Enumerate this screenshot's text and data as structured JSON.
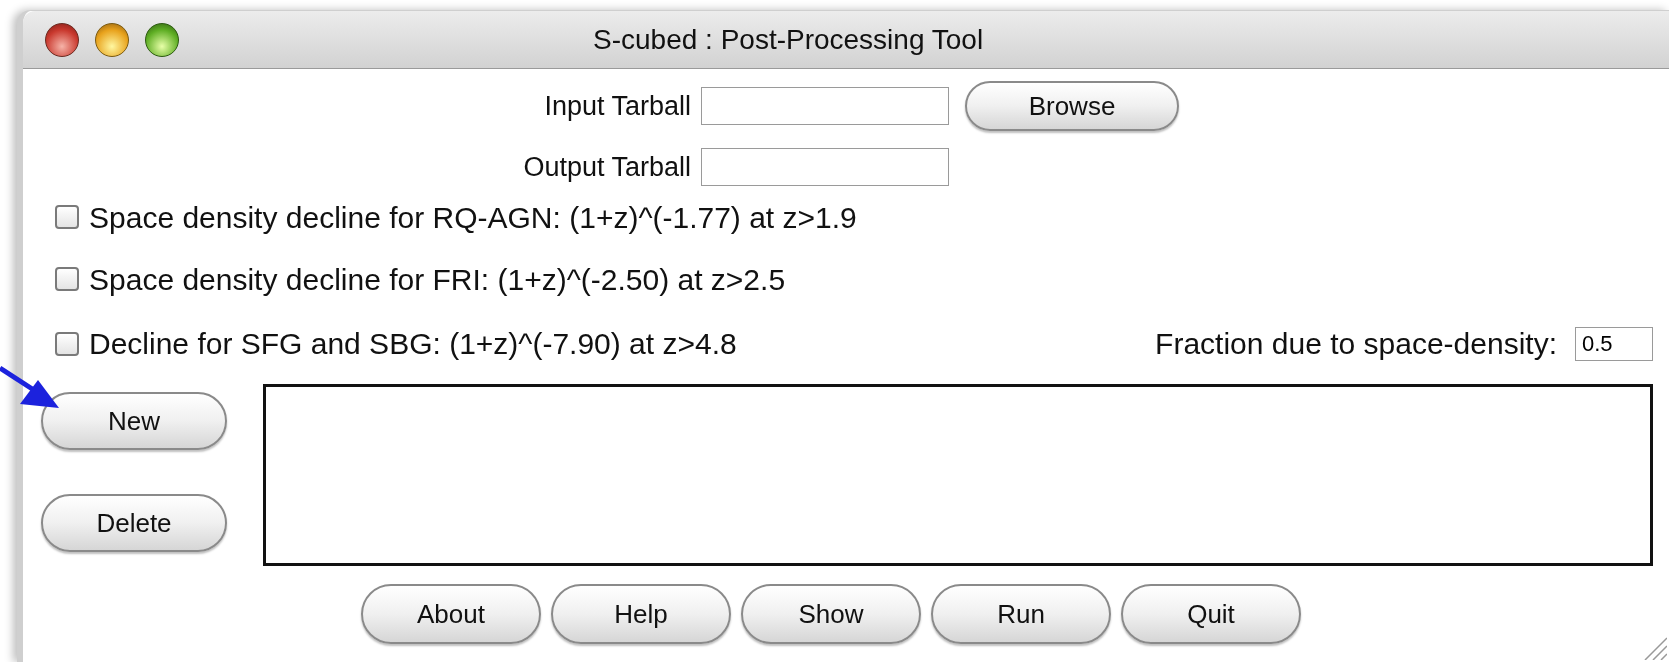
{
  "window": {
    "title": "S-cubed : Post-Processing Tool"
  },
  "tarballs": [
    {
      "label": "Input Tarball",
      "button": "Browse"
    },
    {
      "label": "Output Tarball"
    }
  ],
  "options": [
    {
      "label": "Space density decline for RQ-AGN: (1+z)^(-1.77) at z>1.9",
      "checked": false
    },
    {
      "label": "Space density decline for FRI: (1+z)^(-2.50) at z>2.5",
      "checked": false
    },
    {
      "label": "Decline for SFG and SBG: (1+z)^(-7.90) at z>4.8",
      "checked": false
    }
  ],
  "fraction": {
    "label": "Fraction due to space-density:",
    "value": "0.5"
  },
  "side_buttons": [
    "New",
    "Delete"
  ],
  "buttons": [
    "About",
    "Help",
    "Show",
    "Run",
    "Quit"
  ]
}
